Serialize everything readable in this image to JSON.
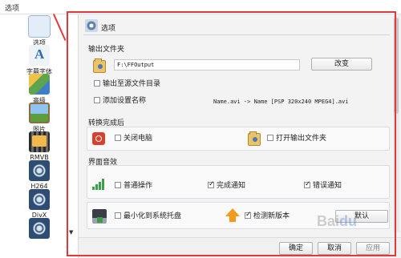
{
  "window": {
    "title": "选项"
  },
  "sidebar": {
    "items": [
      {
        "label": "选项",
        "icon": "gear-icon",
        "selected": true
      },
      {
        "label": "字幕字体",
        "icon": "font-icon"
      },
      {
        "label": "高级",
        "icon": "advanced-icon"
      },
      {
        "label": "图片",
        "icon": "picture-icon"
      },
      {
        "label": "RMVB",
        "icon": "film-icon"
      },
      {
        "label": "H264",
        "icon": "reel-icon"
      },
      {
        "label": "DivX",
        "icon": "reel-icon"
      },
      {
        "label": "",
        "icon": "reel-icon"
      }
    ]
  },
  "page": {
    "title": "选项",
    "output_folder": {
      "label": "输出文件夹",
      "path": "F:\\FFOutput",
      "change_button": "改变",
      "output_to_source": "输出至源文件目录",
      "add_setting_name": "添加设置名称",
      "example": "Name.avi  -> Name [PSP 320x240 MPEG4].avi"
    },
    "after_convert": {
      "label": "转换完成后",
      "shutdown": "关闭电脑",
      "open_output": "打开输出文件夹"
    },
    "ui_effects": {
      "label": "界面音效",
      "normal_op": "普通操作",
      "complete_notify": "完成通知",
      "error_notify": "错误通知"
    },
    "misc": {
      "minimize_tray": "最小化到系统托盘",
      "check_update": "检测新版本"
    },
    "default_button": "默认"
  },
  "footer": {
    "ok": "确定",
    "cancel": "取消",
    "apply": "应用"
  },
  "colors": {
    "highlight": "#e23a3a",
    "accent": "#2c6cbf"
  }
}
